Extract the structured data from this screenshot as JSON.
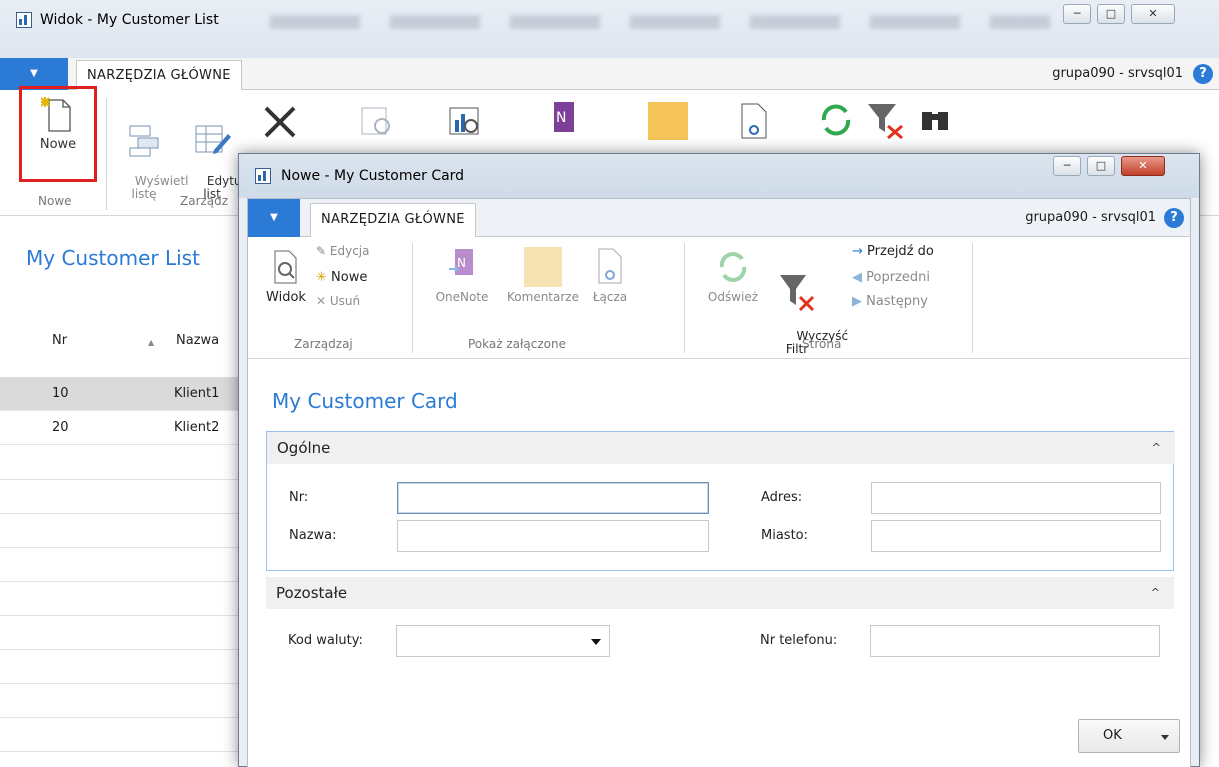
{
  "background_window": {
    "title": "Widok - My Customer List",
    "tab": "NARZĘDZIA GŁÓWNE",
    "server": "grupa090 - srvsql01",
    "help": "?",
    "ribbon": {
      "new": "Nowe",
      "view_list": "Wyświetl\nlistę",
      "edit_list": "Edytu\nlist",
      "group_new": "Nowe",
      "group_manage": "Zarządz"
    },
    "list_title": "My Customer List",
    "columns": {
      "nr": "Nr",
      "name": "Nazwa"
    },
    "rows": [
      {
        "nr": "10",
        "name": "Klient1"
      },
      {
        "nr": "20",
        "name": "Klient2"
      }
    ]
  },
  "dialog": {
    "title": "Nowe - My Customer Card",
    "tab": "NARZĘDZIA GŁÓWNE",
    "server": "grupa090 - srvsql01",
    "help": "?",
    "ribbon": {
      "view": "Widok",
      "edit": "Edycja",
      "new": "Nowe",
      "delete": "Usuń",
      "group_manage": "Zarządzaj",
      "onenote": "OneNote",
      "comments": "Komentarze",
      "links": "Łącza",
      "group_attachments": "Pokaż załączone",
      "refresh": "Odśwież",
      "clear_filter": "Wyczyść\nFiltr",
      "goto": "Przejdź do",
      "previous": "Poprzedni",
      "next": "Następny",
      "group_page": "Strona"
    },
    "card_title": "My Customer Card",
    "sections": {
      "general": {
        "title": "Ogólne",
        "nr_label": "Nr:",
        "nr_value": "",
        "name_label": "Nazwa:",
        "name_value": "",
        "address_label": "Adres:",
        "address_value": "",
        "city_label": "Miasto:",
        "city_value": ""
      },
      "other": {
        "title": "Pozostałe",
        "currency_label": "Kod waluty:",
        "currency_value": "",
        "phone_label": "Nr telefonu:",
        "phone_value": ""
      }
    },
    "ok": "OK"
  }
}
